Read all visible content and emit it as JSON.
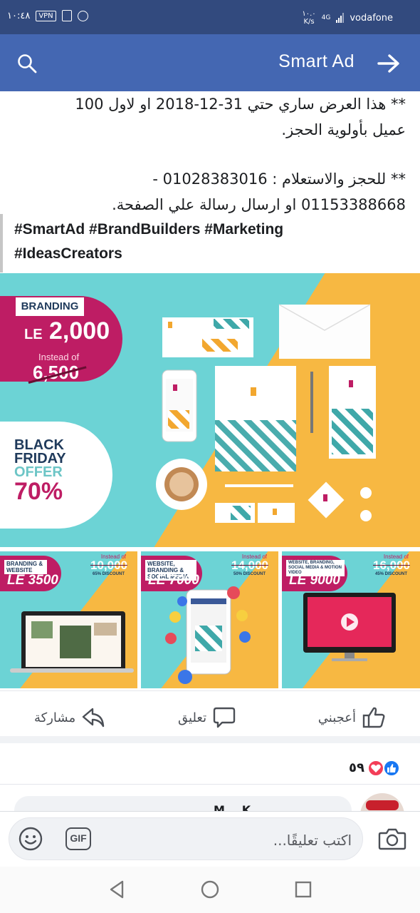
{
  "status_bar": {
    "time": "١٠:٤٨",
    "vpn_badge": "VPN",
    "speed_top": "١٠.٠",
    "speed_unit": "K/s",
    "network": "4G",
    "carrier": "vodafone"
  },
  "app_bar": {
    "title": "Smart Ad"
  },
  "post": {
    "offer_line1": "** هذا العرض ساري حتي 31-12-2018 او لاول 100",
    "offer_line2": "عميل بأولوية الحجز.",
    "contact_line1": "** للحجز والاستعلام : 01028383016 -",
    "contact_line2": "01153388668 او ارسال رسالة علي الصفحة.",
    "hashtags_line1": "#SmartAd #BrandBuilders #Marketing",
    "hashtags_line2": "#IdeasCreators"
  },
  "main_image": {
    "label": "BRANDING",
    "price_prefix": "LE",
    "price": "2,000",
    "instead_of": "Instead of",
    "old_price": "6,500",
    "black": "BLACK",
    "friday": "FRIDAY",
    "offer": "OFFER",
    "discount": "70%"
  },
  "thumbnails": [
    {
      "label": "BRANDING & WEBSITE",
      "price": "LE 3500",
      "instead_of": "Instead of",
      "old_price": "10,000",
      "discount": "65% DISCOUNT"
    },
    {
      "label": "WEBSITE, BRANDING & SOCIAL MEDIA",
      "price": "LE 7000",
      "instead_of": "Instead of",
      "old_price": "14,000",
      "discount": "50% DISCOUNT"
    },
    {
      "label": "WEBSITE, BRANDING, SOCIAL MEDIA & MOTION VIDEO",
      "price": "LE 9000",
      "instead_of": "Instead of",
      "old_price": "16,000",
      "discount": "45% DISCOUNT"
    }
  ],
  "actions": {
    "like": "أعجبني",
    "comment": "تعليق",
    "share": "مشاركة"
  },
  "reactions": {
    "count": "٥٩"
  },
  "comment_peek": {
    "name": "M... K..."
  },
  "composer": {
    "placeholder": "اكتب تعليقًا...",
    "gif": "GIF"
  },
  "colors": {
    "status_bar": "#324a7e",
    "app_bar": "#4467b2",
    "teal": "#6cd3d5",
    "orange": "#f7b842",
    "magenta": "#be1d64",
    "navy": "#1f3a5b"
  },
  "icons": {
    "search": "search-icon",
    "back": "arrow-right-icon",
    "like": "thumbs-up-icon",
    "comment": "speech-bubble-icon",
    "share": "share-arrow-icon",
    "emoji": "smiley-icon",
    "camera": "camera-icon",
    "nav_back": "triangle-back-icon",
    "nav_home": "circle-home-icon",
    "nav_recent": "square-recent-icon"
  }
}
